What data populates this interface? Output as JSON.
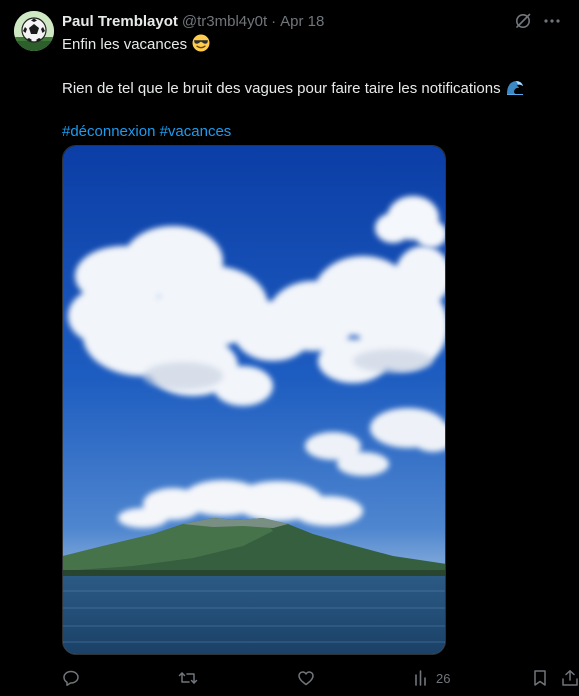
{
  "tweet": {
    "author_name": "Paul Tremblayot",
    "handle": "@tr3mbl4y0t",
    "separator": "·",
    "date": "Apr 18",
    "line1": "Enfin les vacances",
    "line1_emoji": "smiling-face-with-sunglasses",
    "line2": "Rien de tel que le bruit des vagues pour faire taire les notifications",
    "line2_emoji": "water-wave",
    "hashtags": [
      "#déconnexion",
      "#vacances"
    ]
  },
  "media": {
    "description_icon": "photo",
    "sky_color": "#1a4fb0",
    "sea_color": "#1f4a78"
  },
  "actions": {
    "reply_count": "",
    "retweet_count": "",
    "like_count": "",
    "views_count": "26"
  },
  "icons": {
    "header_right": [
      "grok-icon",
      "more-icon"
    ],
    "actions": [
      "reply-icon",
      "retweet-icon",
      "like-icon",
      "views-icon",
      "bookmark-icon",
      "share-icon"
    ]
  },
  "colors": {
    "background": "#000000",
    "text": "#e7e9ea",
    "muted": "#71767b",
    "link": "#1d9bf0"
  }
}
